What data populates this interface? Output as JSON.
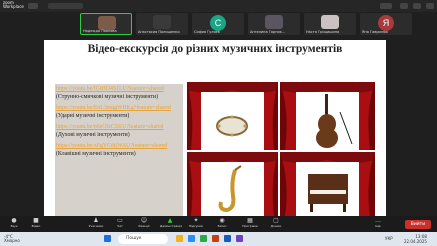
{
  "app": {
    "brand_line1": "zoom",
    "brand_line2": "Workplace",
    "chat_label": "Чат",
    "top_right": "Вид"
  },
  "participants": [
    {
      "name": "Надежда Павлова",
      "kind": "photo",
      "color": "#7c5c48"
    },
    {
      "name": "Анастасия Полищенко",
      "kind": "photo",
      "color": "#3a3a3a"
    },
    {
      "name": "София Гуляев",
      "kind": "letter",
      "letter": "С",
      "color": "#1aa587"
    },
    {
      "name": "Ангелина Горник...",
      "kind": "photo",
      "color": "#5a5560"
    },
    {
      "name": "Настя Грицишина",
      "kind": "photo",
      "color": "#c9c2c0"
    },
    {
      "name": "Яна Гаврилюк",
      "kind": "letter",
      "letter": "Я",
      "color": "#a93a3a"
    }
  ],
  "slide": {
    "title": "Відео-екскурсія до різних музичних інструментів",
    "items": [
      {
        "link": "https://youtu.be/fGtHD4S1LU?feature=shared",
        "label": "(Струнно-смичкові музичні інструменти)"
      },
      {
        "link": "https://youtu.be/EoL3mqgWHKg?feature=shared",
        "label": "(Ударні музичні інструменти)"
      },
      {
        "link": "https://youtu.be/n6eOlxCSKU?feature=shared",
        "label": "(Духові музичні інструменти)"
      },
      {
        "link": "https://youtu.be/xFgYCdtjWAU?feature=shared",
        "label": "(Клавішні музичні інструменти)"
      }
    ],
    "images": [
      {
        "instrument": "tambourine"
      },
      {
        "instrument": "double-bass"
      },
      {
        "instrument": "saxophone"
      },
      {
        "instrument": "piano"
      }
    ]
  },
  "toolbar": [
    {
      "icon": "microphone-icon",
      "label": "Звук"
    },
    {
      "icon": "video-camera-icon",
      "label": "Відео"
    },
    {
      "icon": "participants-icon",
      "label": "Учасники"
    },
    {
      "icon": "chat-icon",
      "label": "Чат"
    },
    {
      "icon": "reaction-icon",
      "label": "Реакції"
    },
    {
      "icon": "share-screen-icon",
      "label": "Демонстрація"
    },
    {
      "icon": "summary-icon",
      "label": "Підсумок"
    },
    {
      "icon": "record-icon",
      "label": "Запис"
    },
    {
      "icon": "apps-icon",
      "label": "Програми"
    },
    {
      "icon": "whiteboard-icon",
      "label": "Дошки"
    },
    {
      "icon": "more-icon",
      "label": "Ще"
    }
  ],
  "end_button": "Вийти",
  "taskbar": {
    "weather_temp": "-4°C",
    "weather_desc": "Хмарно",
    "search_placeholder": "Пошук",
    "language": "УКР",
    "time": "13:08",
    "date": "22.04.2025"
  },
  "colors": {
    "link": "#e8a33a",
    "curtain": "#a90f12",
    "end_button": "#c9302c",
    "speaker_border": "#2ecc40"
  }
}
